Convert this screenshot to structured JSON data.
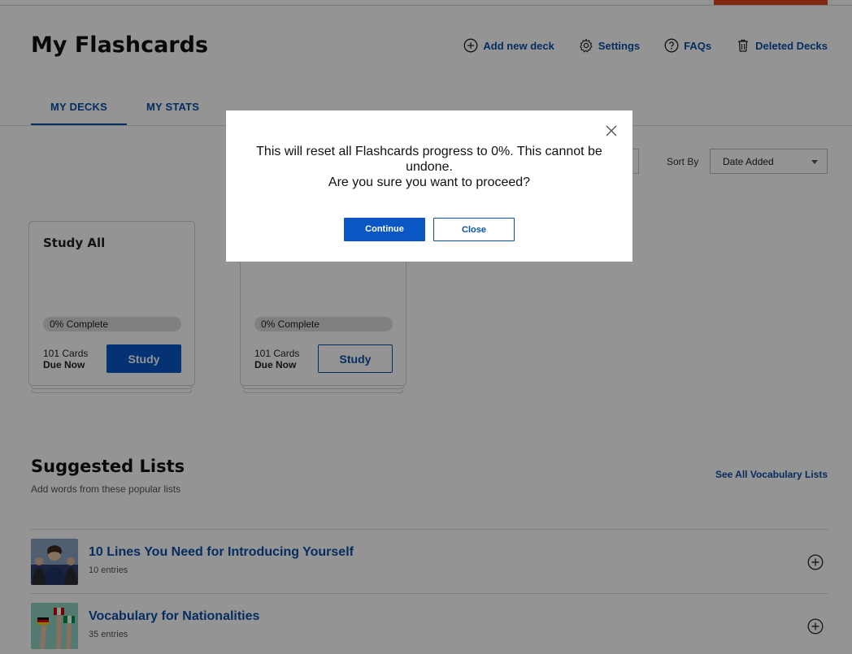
{
  "page": {
    "title": "My Flashcards",
    "header_links": [
      {
        "label": "Add new deck",
        "icon": "plus-circle-icon"
      },
      {
        "label": "Settings",
        "icon": "gear-icon"
      },
      {
        "label": "FAQs",
        "icon": "question-circle-icon"
      },
      {
        "label": "Deleted Decks",
        "icon": "trash-icon"
      }
    ]
  },
  "tabs": [
    {
      "label": "MY DECKS",
      "active": true
    },
    {
      "label": "MY STATS",
      "active": false
    }
  ],
  "controls": {
    "sort_label": "Sort By",
    "sort_value": "Date Added"
  },
  "decks": [
    {
      "title": "Study All",
      "progress_label": "0% Complete",
      "progress": 0,
      "cards": "101 Cards",
      "due": "Due Now",
      "button": "Study"
    },
    {
      "title": "",
      "progress_label": "0% Complete",
      "progress": 0,
      "cards": "101 Cards",
      "due": "Due Now",
      "button": "Study"
    }
  ],
  "suggested": {
    "title": "Suggested Lists",
    "subtitle": "Add words from these popular lists",
    "see_all": "See All Vocabulary Lists",
    "items": [
      {
        "title": "10 Lines You Need for Introducing Yourself",
        "entries": "10 entries"
      },
      {
        "title": "Vocabulary for Nationalities",
        "entries": "35 entries"
      }
    ]
  },
  "modal": {
    "line1": "This will reset all Flashcards progress to 0%. This cannot be undone.",
    "line2": "Are you sure you want to proceed?",
    "continue_label": "Continue",
    "close_label": "Close"
  },
  "colors": {
    "brand_blue": "#0a4fa6",
    "button_blue": "#0a56c5",
    "accent_orange": "#e0451a"
  }
}
